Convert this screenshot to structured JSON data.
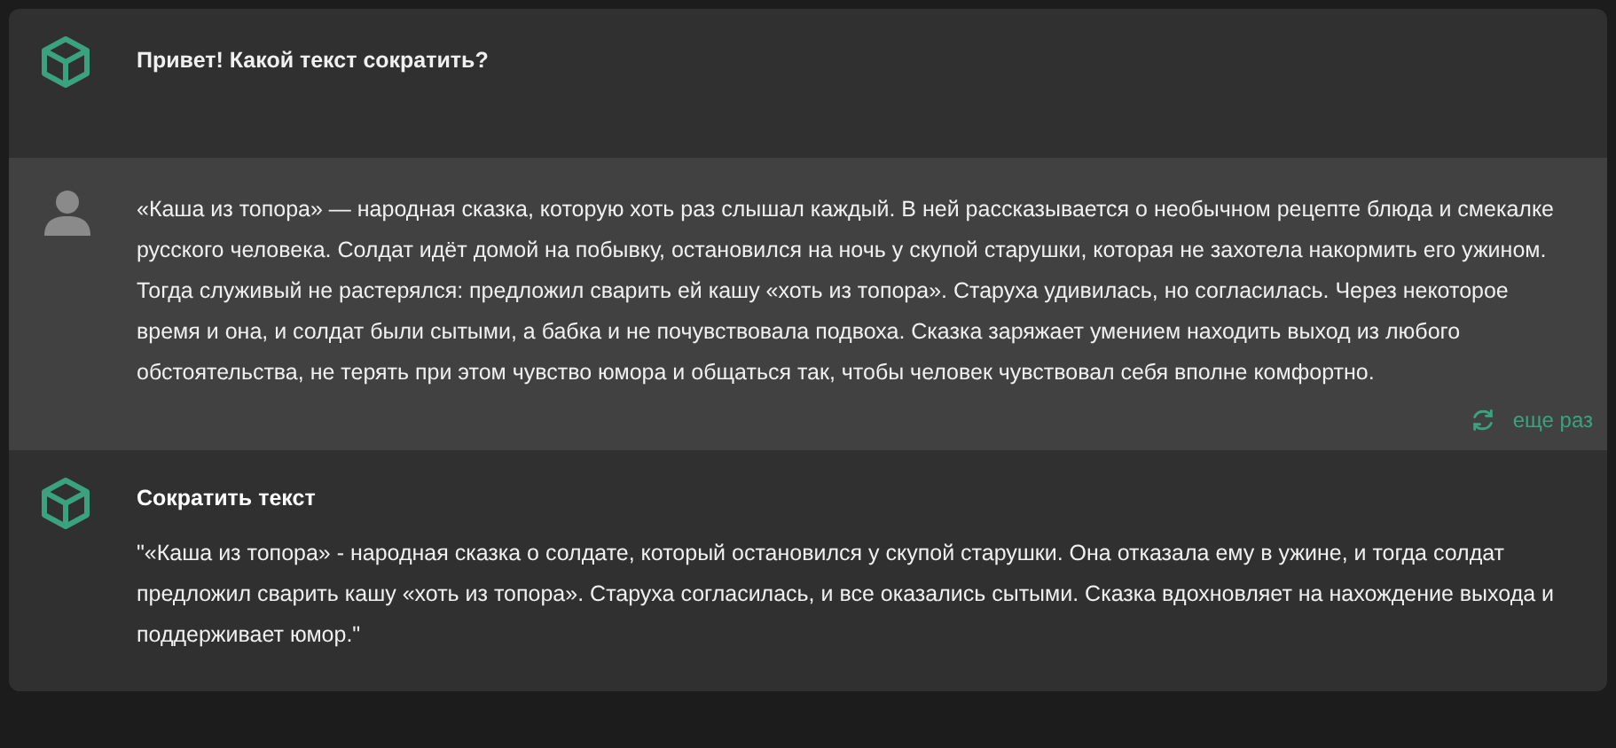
{
  "messages": [
    {
      "kind": "bot",
      "text": "Привет! Какой текст сократить?"
    },
    {
      "kind": "user",
      "text": "«Каша из топора» — народная сказка, которую хоть раз слышал каждый. В ней рассказывается о необычном рецепте блюда и смекалке русского человека. Солдат идёт домой на побывку, остановился на ночь у скупой старушки, которая не захотела накормить его ужином. Тогда служивый не растерялся: предложил сварить ей кашу «хоть из топора». Старуха удивилась, но согласилась. Через некоторое время и она, и солдат были сытыми, а бабка и не почувствовала подвоха. Сказка заряжает умением находить выход из любого обстоятельства, не терять при этом чувство юмора и общаться так, чтобы человек чувствовал себя вполне комфортно.",
      "action": "еще раз"
    },
    {
      "kind": "bot",
      "title": "Сократить текст",
      "text": "\"«Каша из топора» - народная сказка о солдате, который остановился у скупой старушки. Она отказала ему в ужине, и тогда солдат предложил сварить кашу «хоть из топора». Старуха согласилась, и все оказались сытыми. Сказка вдохновляет на нахождение выхода и поддерживает юмор.\""
    }
  ]
}
